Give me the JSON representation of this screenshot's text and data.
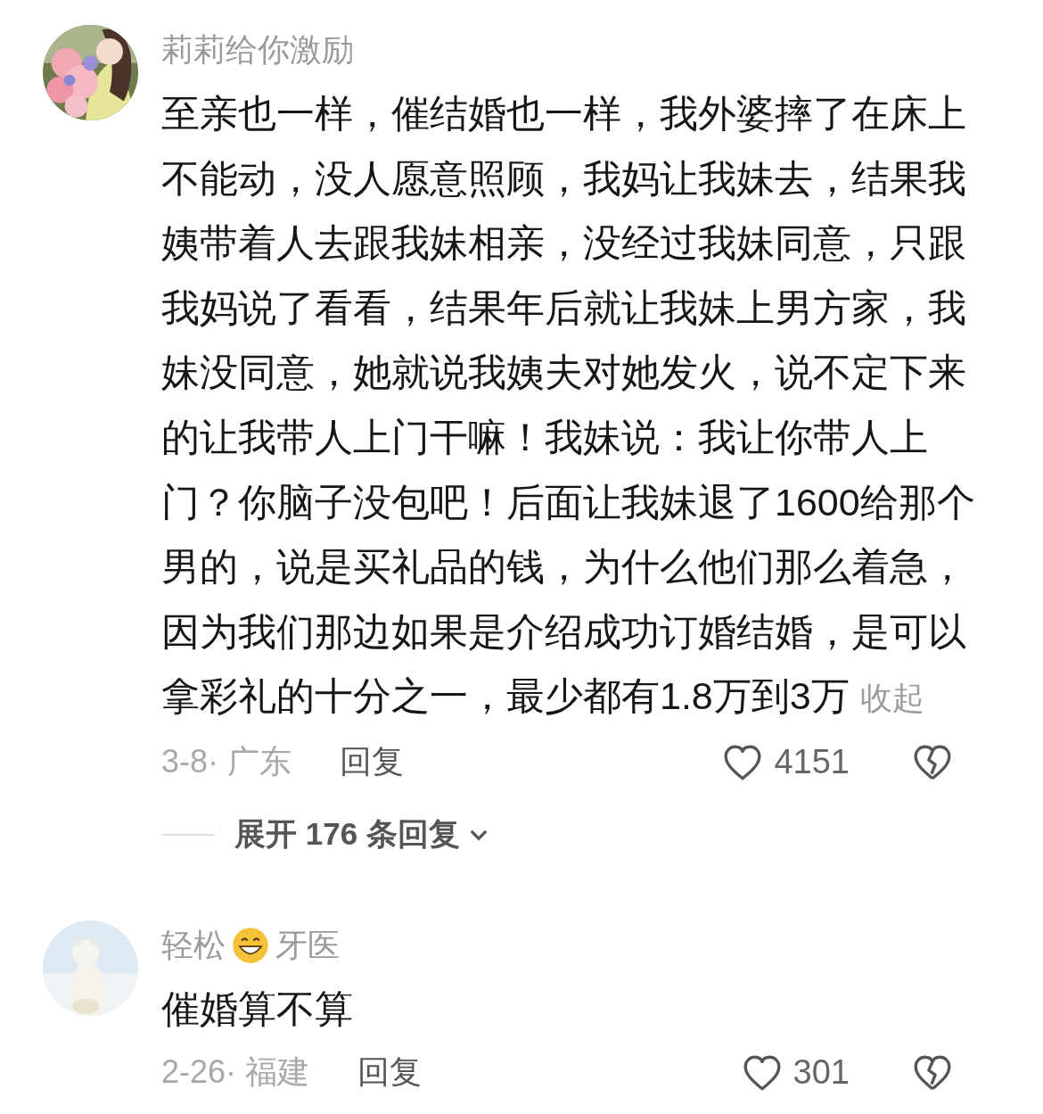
{
  "comments": [
    {
      "username": "莉莉给你激励",
      "text": "至亲也一样，催结婚也一样，我外婆摔了在床上不能动，没人愿意照顾，我妈让我妹去，结果我姨带着人去跟我妹相亲，没经过我妹同意，只跟我妈说了看看，结果年后就让我妹上男方家，我妹没同意，她就说我姨夫对她发火，说不定下来的让我带人上门干嘛！我妹说：我让你带人上门？你脑子没包吧！后面让我妹退了1600给那个男的，说是买礼品的钱，为什么他们那么着急，因为我们那边如果是介绍成功订婚结婚，是可以拿彩礼的十分之一，最少都有1.8万到3万",
      "collapse_link": "收起",
      "meta": "3-8· 广东",
      "reply_button": "回复",
      "likes": "4151",
      "expand_replies": "展开 176 条回复"
    },
    {
      "username": "轻松",
      "username_suffix": "牙医",
      "text": "催婚算不算",
      "meta": "2-26· 福建",
      "reply_button": "回复",
      "likes": "301"
    }
  ]
}
